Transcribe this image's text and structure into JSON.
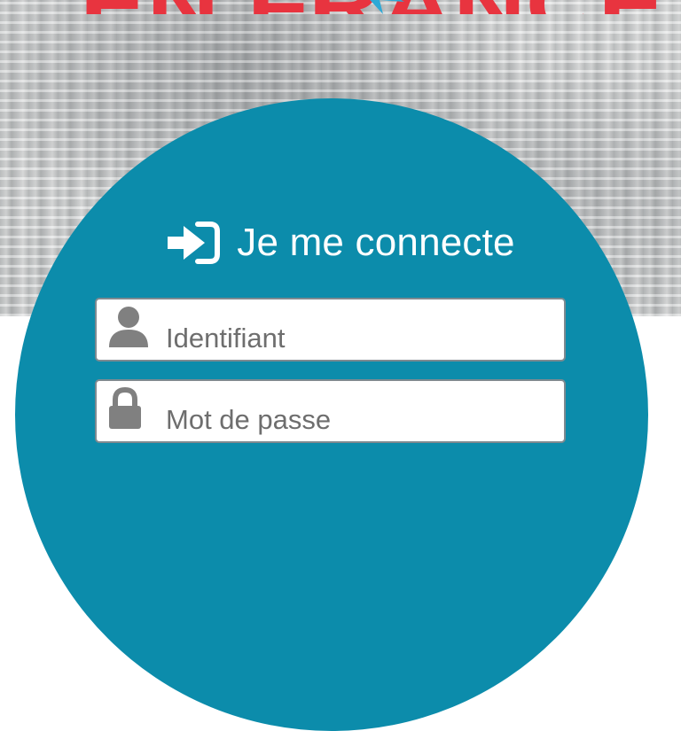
{
  "header": {
    "brand_text": "EN FRANCE"
  },
  "login": {
    "title": "Je me connecte",
    "username_field": {
      "placeholder": "Identifiant",
      "value": ""
    },
    "password_field": {
      "placeholder": "Mot de passe",
      "value": ""
    }
  },
  "colors": {
    "panel": "#0c8cab",
    "logo_red": "#e8343f",
    "logo_blue": "#2ea9d6",
    "icon_gray": "#808080",
    "field_border": "#7f8a90"
  },
  "icons": {
    "title_icon": "sign-in-icon",
    "username_icon": "user-icon",
    "password_icon": "lock-icon"
  }
}
